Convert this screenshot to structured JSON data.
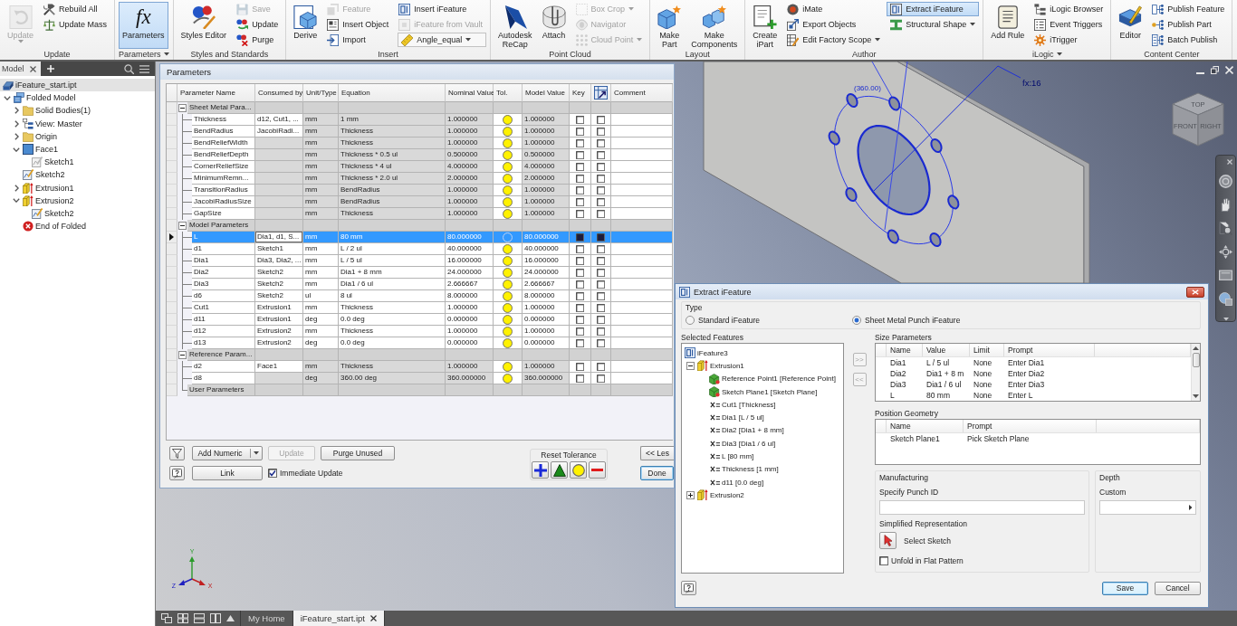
{
  "ribbon": {
    "groups": [
      {
        "label": "Update",
        "dropdown": false,
        "columns": [
          [
            {
              "kind": "large",
              "label": "Update",
              "disabled": true,
              "active": false,
              "dropdown": true
            }
          ],
          [
            {
              "kind": "small",
              "label": "Rebuild All",
              "disabled": false,
              "active": false,
              "dropdown": false
            },
            {
              "kind": "small",
              "label": "Update Mass",
              "disabled": false,
              "active": false,
              "dropdown": false
            }
          ]
        ]
      },
      {
        "label": "Parameters",
        "dropdown": true,
        "columns": [
          [
            {
              "kind": "large",
              "label": "Parameters",
              "icon_text": "fx",
              "disabled": false,
              "active": true,
              "dropdown": false
            }
          ]
        ]
      },
      {
        "label": "Styles and Standards",
        "dropdown": false,
        "columns": [
          [
            {
              "kind": "large",
              "label": "Styles Editor",
              "disabled": false,
              "active": false,
              "dropdown": false
            }
          ],
          [
            {
              "kind": "small",
              "label": "Save",
              "disabled": true,
              "active": false,
              "dropdown": false
            },
            {
              "kind": "small",
              "label": "Update",
              "disabled": false,
              "active": false,
              "dropdown": false
            },
            {
              "kind": "small",
              "label": "Purge",
              "disabled": false,
              "active": false,
              "dropdown": false
            }
          ]
        ]
      },
      {
        "label": "Insert",
        "dropdown": false,
        "columns": [
          [
            {
              "kind": "large",
              "label": "Derive",
              "disabled": false,
              "active": false,
              "dropdown": false
            }
          ],
          [
            {
              "kind": "small",
              "label": "Feature",
              "disabled": true,
              "active": false,
              "dropdown": false
            },
            {
              "kind": "small",
              "label": "Insert Object",
              "disabled": false,
              "active": false,
              "dropdown": false
            },
            {
              "kind": "small",
              "label": "Import",
              "disabled": false,
              "active": false,
              "dropdown": false
            }
          ],
          [
            {
              "kind": "small",
              "label": "Insert iFeature",
              "disabled": false,
              "active": false,
              "dropdown": false
            },
            {
              "kind": "small",
              "label": "iFeature from Vault",
              "disabled": true,
              "active": false,
              "dropdown": false
            },
            {
              "kind": "combo",
              "label": "Angle_equal",
              "disabled": false,
              "active": false,
              "dropdown": true
            }
          ]
        ]
      },
      {
        "label": "Point Cloud",
        "dropdown": false,
        "columns": [
          [
            {
              "kind": "large",
              "label": "Autodesk\nReCap",
              "disabled": false,
              "active": false,
              "dropdown": false
            }
          ],
          [
            {
              "kind": "large",
              "label": "Attach",
              "disabled": false,
              "active": false,
              "dropdown": false
            }
          ],
          [
            {
              "kind": "small",
              "label": "Box Crop",
              "disabled": true,
              "active": false,
              "dropdown": true
            },
            {
              "kind": "small",
              "label": "Navigator",
              "disabled": true,
              "active": false,
              "dropdown": false
            },
            {
              "kind": "small",
              "label": "Cloud Point",
              "disabled": true,
              "active": false,
              "dropdown": true
            }
          ]
        ]
      },
      {
        "label": "Layout",
        "dropdown": false,
        "columns": [
          [
            {
              "kind": "large",
              "label": "Make\nPart",
              "disabled": false,
              "active": false,
              "dropdown": false
            }
          ],
          [
            {
              "kind": "large",
              "label": "Make\nComponents",
              "disabled": false,
              "active": false,
              "dropdown": false
            }
          ]
        ]
      },
      {
        "label": "Author",
        "dropdown": false,
        "columns": [
          [
            {
              "kind": "large",
              "label": "Create\niPart",
              "disabled": false,
              "active": false,
              "dropdown": false
            }
          ],
          [
            {
              "kind": "small",
              "label": "iMate",
              "disabled": false,
              "active": false,
              "dropdown": false
            },
            {
              "kind": "small",
              "label": "Export Objects",
              "disabled": false,
              "active": false,
              "dropdown": false
            },
            {
              "kind": "small",
              "label": "Edit Factory Scope",
              "disabled": false,
              "active": false,
              "dropdown": true
            }
          ],
          [
            {
              "kind": "small",
              "label": "Extract iFeature",
              "disabled": false,
              "active": true,
              "dropdown": false
            },
            {
              "kind": "small",
              "label": "Structural Shape",
              "disabled": false,
              "active": false,
              "dropdown": true
            }
          ]
        ]
      },
      {
        "label": "iLogic",
        "dropdown": true,
        "columns": [
          [
            {
              "kind": "large",
              "label": "Add Rule",
              "disabled": false,
              "active": false,
              "dropdown": false
            }
          ],
          [
            {
              "kind": "small",
              "label": "iLogic Browser",
              "disabled": false,
              "active": false,
              "dropdown": false
            },
            {
              "kind": "small",
              "label": "Event Triggers",
              "disabled": false,
              "active": false,
              "dropdown": false
            },
            {
              "kind": "small",
              "label": "iTrigger",
              "disabled": false,
              "active": false,
              "dropdown": false
            }
          ]
        ]
      },
      {
        "label": "Content Center",
        "dropdown": false,
        "columns": [
          [
            {
              "kind": "large",
              "label": "Editor",
              "disabled": false,
              "active": false,
              "dropdown": false
            }
          ],
          [
            {
              "kind": "small",
              "label": "Publish Feature",
              "disabled": false,
              "active": false,
              "dropdown": false
            },
            {
              "kind": "small",
              "label": "Publish Part",
              "disabled": false,
              "active": false,
              "dropdown": false
            },
            {
              "kind": "small",
              "label": "Batch Publish",
              "disabled": false,
              "active": false,
              "dropdown": false
            }
          ]
        ]
      }
    ]
  },
  "browser": {
    "tabs": [
      {
        "label": "Model",
        "selected": true
      }
    ],
    "tree": [
      {
        "label": "iFeature_start.ipt",
        "kind": "part",
        "children": [
          {
            "label": "Folded Model",
            "kind": "sheet-metal",
            "expanded": true,
            "children": [
              {
                "label": "Solid Bodies(1)",
                "kind": "folder",
                "expanded": false
              },
              {
                "label": "View: Master",
                "kind": "view",
                "expanded": false
              },
              {
                "label": "Origin",
                "kind": "folder",
                "expanded": false
              },
              {
                "label": "Face1",
                "kind": "face",
                "expanded": true,
                "children": [
                  {
                    "label": "Sketch1",
                    "kind": "sketch-consumed"
                  }
                ]
              },
              {
                "label": "Sketch2",
                "kind": "sketch"
              },
              {
                "label": "Extrusion1",
                "kind": "extrusion",
                "expanded": false
              },
              {
                "label": "Extrusion2",
                "kind": "extrusion",
                "expanded": true,
                "children": [
                  {
                    "label": "Sketch2",
                    "kind": "sketch"
                  }
                ]
              },
              {
                "label": "End of Folded",
                "kind": "end"
              }
            ]
          }
        ]
      }
    ]
  },
  "parameters_dialog": {
    "title": "Parameters",
    "columns": [
      {
        "kind": "text",
        "label": "Parameter Name"
      },
      {
        "kind": "text",
        "label": "Consumed by"
      },
      {
        "kind": "text",
        "label": "Unit/Type"
      },
      {
        "kind": "text",
        "label": "Equation"
      },
      {
        "kind": "text",
        "label": "Nominal Value"
      },
      {
        "kind": "text",
        "label": "Tol."
      },
      {
        "kind": "text",
        "label": "Model Value"
      },
      {
        "kind": "text",
        "label": "Key"
      },
      {
        "kind": "icon"
      },
      {
        "kind": "text",
        "label": "Comment"
      }
    ],
    "groups": [
      {
        "label": "Sheet Metal Para...",
        "expanded": true,
        "rows": [
          {
            "name": "Thickness",
            "consumed_by": "d12, Cut1, ...",
            "unit": "mm",
            "equation": "1 mm",
            "nominal": "1.000000",
            "model": "1.000000",
            "key": false,
            "export": false,
            "read_only": true,
            "selected": false
          },
          {
            "name": "BendRadius",
            "consumed_by": "JacobiRadi...",
            "unit": "mm",
            "equation": "Thickness",
            "nominal": "1.000000",
            "model": "1.000000",
            "key": false,
            "export": false,
            "read_only": true,
            "selected": false
          },
          {
            "name": "BendReliefWidth",
            "unit": "mm",
            "equation": "Thickness",
            "nominal": "1.000000",
            "model": "1.000000",
            "key": false,
            "export": false,
            "read_only": true,
            "selected": false
          },
          {
            "name": "BendReliefDepth",
            "unit": "mm",
            "equation": "Thickness * 0.5 ul",
            "nominal": "0.500000",
            "model": "0.500000",
            "key": false,
            "export": false,
            "read_only": true,
            "selected": false
          },
          {
            "name": "CornerReliefSize",
            "unit": "mm",
            "equation": "Thickness * 4 ul",
            "nominal": "4.000000",
            "model": "4.000000",
            "key": false,
            "export": false,
            "read_only": true,
            "selected": false
          },
          {
            "name": "MinimumRemn...",
            "unit": "mm",
            "equation": "Thickness * 2.0 ul",
            "nominal": "2.000000",
            "model": "2.000000",
            "key": false,
            "export": false,
            "read_only": true,
            "selected": false
          },
          {
            "name": "TransitionRadius",
            "unit": "mm",
            "equation": "BendRadius",
            "nominal": "1.000000",
            "model": "1.000000",
            "key": false,
            "export": false,
            "read_only": true,
            "selected": false
          },
          {
            "name": "JacobiRadiusSize",
            "unit": "mm",
            "equation": "BendRadius",
            "nominal": "1.000000",
            "model": "1.000000",
            "key": false,
            "export": false,
            "read_only": true,
            "selected": false
          },
          {
            "name": "GapSize",
            "unit": "mm",
            "equation": "Thickness",
            "nominal": "1.000000",
            "model": "1.000000",
            "key": false,
            "export": false,
            "read_only": true,
            "selected": false
          }
        ]
      },
      {
        "label": "Model Parameters",
        "expanded": true,
        "rows": [
          {
            "name": "L",
            "consumed_by": "Dia1, d1, S...",
            "unit": "mm",
            "equation": "80 mm",
            "nominal": "80.000000",
            "model": "80.000000",
            "key": false,
            "export": false,
            "read_only": false,
            "selected": true
          },
          {
            "name": "d1",
            "consumed_by": "Sketch1",
            "unit": "mm",
            "equation": "L / 2 ul",
            "nominal": "40.000000",
            "model": "40.000000",
            "key": false,
            "export": false,
            "read_only": false,
            "selected": false
          },
          {
            "name": "Dia1",
            "consumed_by": "Dia3, Dia2, ...",
            "unit": "mm",
            "equation": "L / 5 ul",
            "nominal": "16.000000",
            "model": "16.000000",
            "key": false,
            "export": false,
            "read_only": false,
            "selected": false
          },
          {
            "name": "Dia2",
            "consumed_by": "Sketch2",
            "unit": "mm",
            "equation": "Dia1 + 8 mm",
            "nominal": "24.000000",
            "model": "24.000000",
            "key": false,
            "export": false,
            "read_only": false,
            "selected": false
          },
          {
            "name": "Dia3",
            "consumed_by": "Sketch2",
            "unit": "mm",
            "equation": "Dia1 / 6 ul",
            "nominal": "2.666667",
            "model": "2.666667",
            "key": false,
            "export": false,
            "read_only": false,
            "selected": false
          },
          {
            "name": "d6",
            "consumed_by": "Sketch2",
            "unit": "ul",
            "equation": "8 ul",
            "nominal": "8.000000",
            "model": "8.000000",
            "key": false,
            "export": false,
            "read_only": false,
            "selected": false
          },
          {
            "name": "Cut1",
            "consumed_by": "Extrusion1",
            "unit": "mm",
            "equation": "Thickness",
            "nominal": "1.000000",
            "model": "1.000000",
            "key": false,
            "export": false,
            "read_only": false,
            "selected": false
          },
          {
            "name": "d11",
            "consumed_by": "Extrusion1",
            "unit": "deg",
            "equation": "0.0 deg",
            "nominal": "0.000000",
            "model": "0.000000",
            "key": false,
            "export": false,
            "read_only": false,
            "selected": false
          },
          {
            "name": "d12",
            "consumed_by": "Extrusion2",
            "unit": "mm",
            "equation": "Thickness",
            "nominal": "1.000000",
            "model": "1.000000",
            "key": false,
            "export": false,
            "read_only": false,
            "selected": false
          },
          {
            "name": "d13",
            "consumed_by": "Extrusion2",
            "unit": "deg",
            "equation": "0.0 deg",
            "nominal": "0.000000",
            "model": "0.000000",
            "key": false,
            "export": false,
            "read_only": false,
            "selected": false
          }
        ]
      },
      {
        "label": "Reference Param...",
        "expanded": true,
        "rows": [
          {
            "name": "d2",
            "consumed_by": "Face1",
            "unit": "mm",
            "equation": "Thickness",
            "nominal": "1.000000",
            "model": "1.000000",
            "key": false,
            "export": false,
            "read_only": true,
            "selected": false
          },
          {
            "name": "d8",
            "unit": "deg",
            "equation": "360.00 deg",
            "nominal": "360.000000",
            "model": "360.000000",
            "key": false,
            "export": false,
            "read_only": true,
            "selected": false
          }
        ]
      },
      {
        "label": "User Parameters"
      }
    ],
    "add_numeric": {
      "label": "Add Numeric"
    },
    "update_button": {
      "label": "Update",
      "disabled": true
    },
    "purge_button": {
      "label": "Purge Unused",
      "disabled": false
    },
    "link_button": {
      "label": "Link"
    },
    "immediate_update": {
      "label": "Immediate Update",
      "checked": true
    },
    "reset_tolerance": {
      "label": "Reset Tolerance",
      "buttons": [
        {
          "kind": "upper"
        },
        {
          "kind": "median"
        },
        {
          "kind": "nominal"
        },
        {
          "kind": "lower"
        }
      ]
    },
    "less_button": {
      "label": "<< Les"
    },
    "done_button": {
      "label": "Done",
      "default": true
    }
  },
  "viewport": {
    "annotations": [
      {
        "kind": "note",
        "label": "(360.00)"
      },
      {
        "kind": "dimension",
        "label": "fx:16"
      }
    ],
    "view_cube": {
      "labels": [
        "TOP",
        "FRONT",
        "RIGHT"
      ]
    },
    "triad": {
      "labels": [
        "X",
        "Y",
        "Z"
      ]
    }
  },
  "extract_dialog": {
    "title": "Extract iFeature",
    "type": {
      "label": "Type",
      "options": [
        {
          "label": "Standard iFeature",
          "selected": false
        },
        {
          "label": "Sheet Metal Punch iFeature",
          "selected": true
        }
      ]
    },
    "selected_features": {
      "label": "Selected Features",
      "tree": [
        {
          "label": "iFeature3",
          "kind": "ifeature",
          "children": [
            {
              "label": "Extrusion1",
              "kind": "extrusion",
              "expanded": true,
              "children": [
                {
                  "label": "Reference Point1 [Reference Point]",
                  "kind": "geometry"
                },
                {
                  "label": "Sketch Plane1 [Sketch Plane]",
                  "kind": "geometry"
                },
                {
                  "label": "Cut1 [Thickness]",
                  "kind": "parameter"
                },
                {
                  "label": "Dia1 [L / 5 ul]",
                  "kind": "parameter"
                },
                {
                  "label": "Dia2 [Dia1 + 8 mm]",
                  "kind": "parameter"
                },
                {
                  "label": "Dia3 [Dia1 / 6 ul]",
                  "kind": "parameter"
                },
                {
                  "label": "L [80 mm]",
                  "kind": "parameter"
                },
                {
                  "label": "Thickness [1 mm]",
                  "kind": "parameter"
                },
                {
                  "label": "d11 [0.0 deg]",
                  "kind": "parameter"
                }
              ]
            },
            {
              "label": "Extrusion2",
              "kind": "extrusion",
              "expanded": false
            }
          ]
        }
      ]
    },
    "move_buttons": [
      {
        "label": ">>",
        "disabled": true
      },
      {
        "label": "<<",
        "disabled": true
      }
    ],
    "size_parameters": {
      "label": "Size Parameters",
      "columns": [
        "Name",
        "Value",
        "Limit",
        "Prompt"
      ],
      "rows": [
        [
          "Dia1",
          "L / 5 ul",
          "None",
          "Enter Dia1"
        ],
        [
          "Dia2",
          "Dia1 + 8 m",
          "None",
          "Enter Dia2"
        ],
        [
          "Dia3",
          "Dia1 / 6 ul",
          "None",
          "Enter Dia3"
        ],
        [
          "L",
          "80 mm",
          "None",
          "Enter L"
        ]
      ]
    },
    "position_geometry": {
      "label": "Position Geometry",
      "columns": [
        "Name",
        "Prompt"
      ],
      "rows": [
        [
          "Sketch Plane1",
          "Pick Sketch Plane"
        ]
      ]
    },
    "manufacturing": {
      "label": "Manufacturing",
      "punch_id_label": "Specify Punch ID"
    },
    "depth": {
      "label": "Depth",
      "field_label": "Custom"
    },
    "simplified_representation": {
      "label": "Simplified Representation",
      "action": "Select Sketch"
    },
    "unfold": {
      "label": "Unfold in Flat Pattern",
      "checked": false
    },
    "buttons": [
      {
        "label": "Save",
        "default": true
      },
      {
        "label": "Cancel",
        "default": false
      }
    ]
  },
  "document_tabs": [
    {
      "label": "My Home",
      "selected": false,
      "closable": false
    },
    {
      "label": "iFeature_start.ipt",
      "selected": true,
      "closable": true
    }
  ]
}
